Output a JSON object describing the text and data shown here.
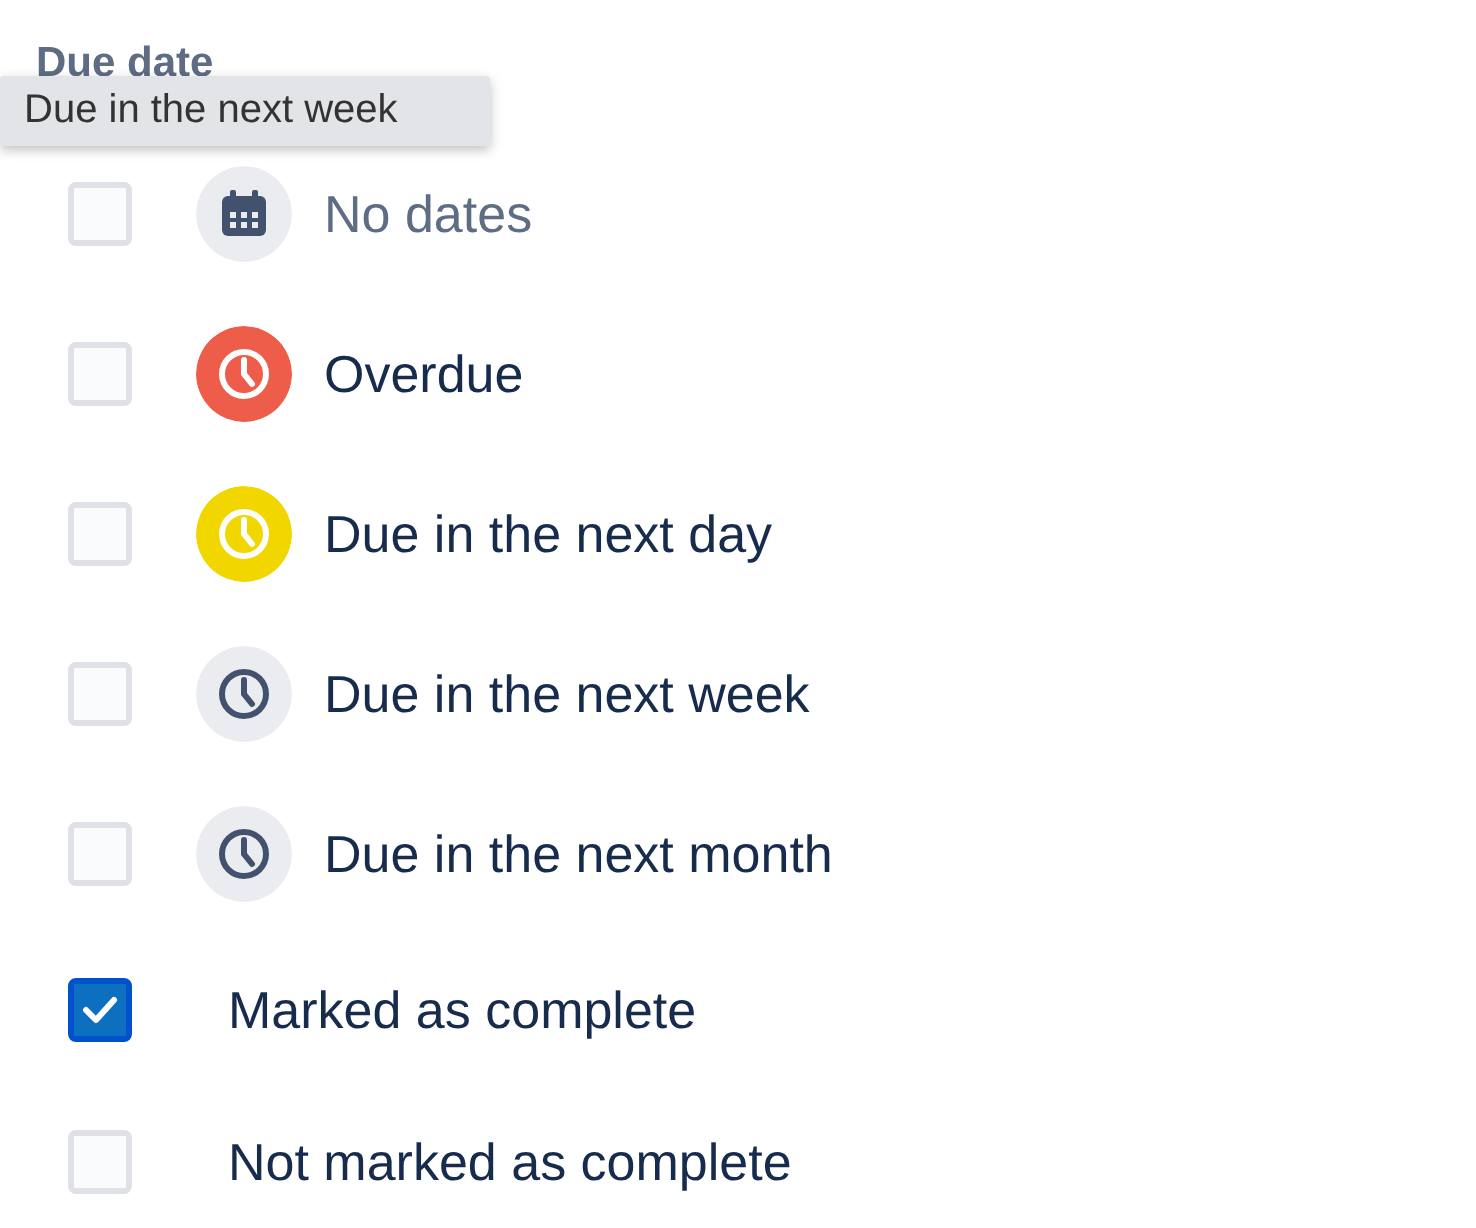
{
  "heading": "Due date",
  "tooltip": "Due in the next week",
  "options": [
    {
      "label": "No dates",
      "checked": false,
      "muted": true,
      "icon": {
        "kind": "calendar",
        "color": "#ebecf0"
      }
    },
    {
      "label": "Overdue",
      "checked": false,
      "muted": false,
      "icon": {
        "kind": "clock",
        "color": "#ee5d4a"
      }
    },
    {
      "label": "Due in the next day",
      "checked": false,
      "muted": false,
      "icon": {
        "kind": "clock",
        "color": "#f2d600"
      }
    },
    {
      "label": "Due in the next week",
      "checked": false,
      "muted": false,
      "icon": {
        "kind": "clock",
        "color": "#ebecf0"
      }
    },
    {
      "label": "Due in the next month",
      "checked": false,
      "muted": false,
      "icon": {
        "kind": "clock",
        "color": "#ebecf0"
      }
    },
    {
      "label": "Marked as complete",
      "checked": true,
      "muted": false
    },
    {
      "label": "Not marked as complete",
      "checked": false,
      "muted": false
    }
  ]
}
